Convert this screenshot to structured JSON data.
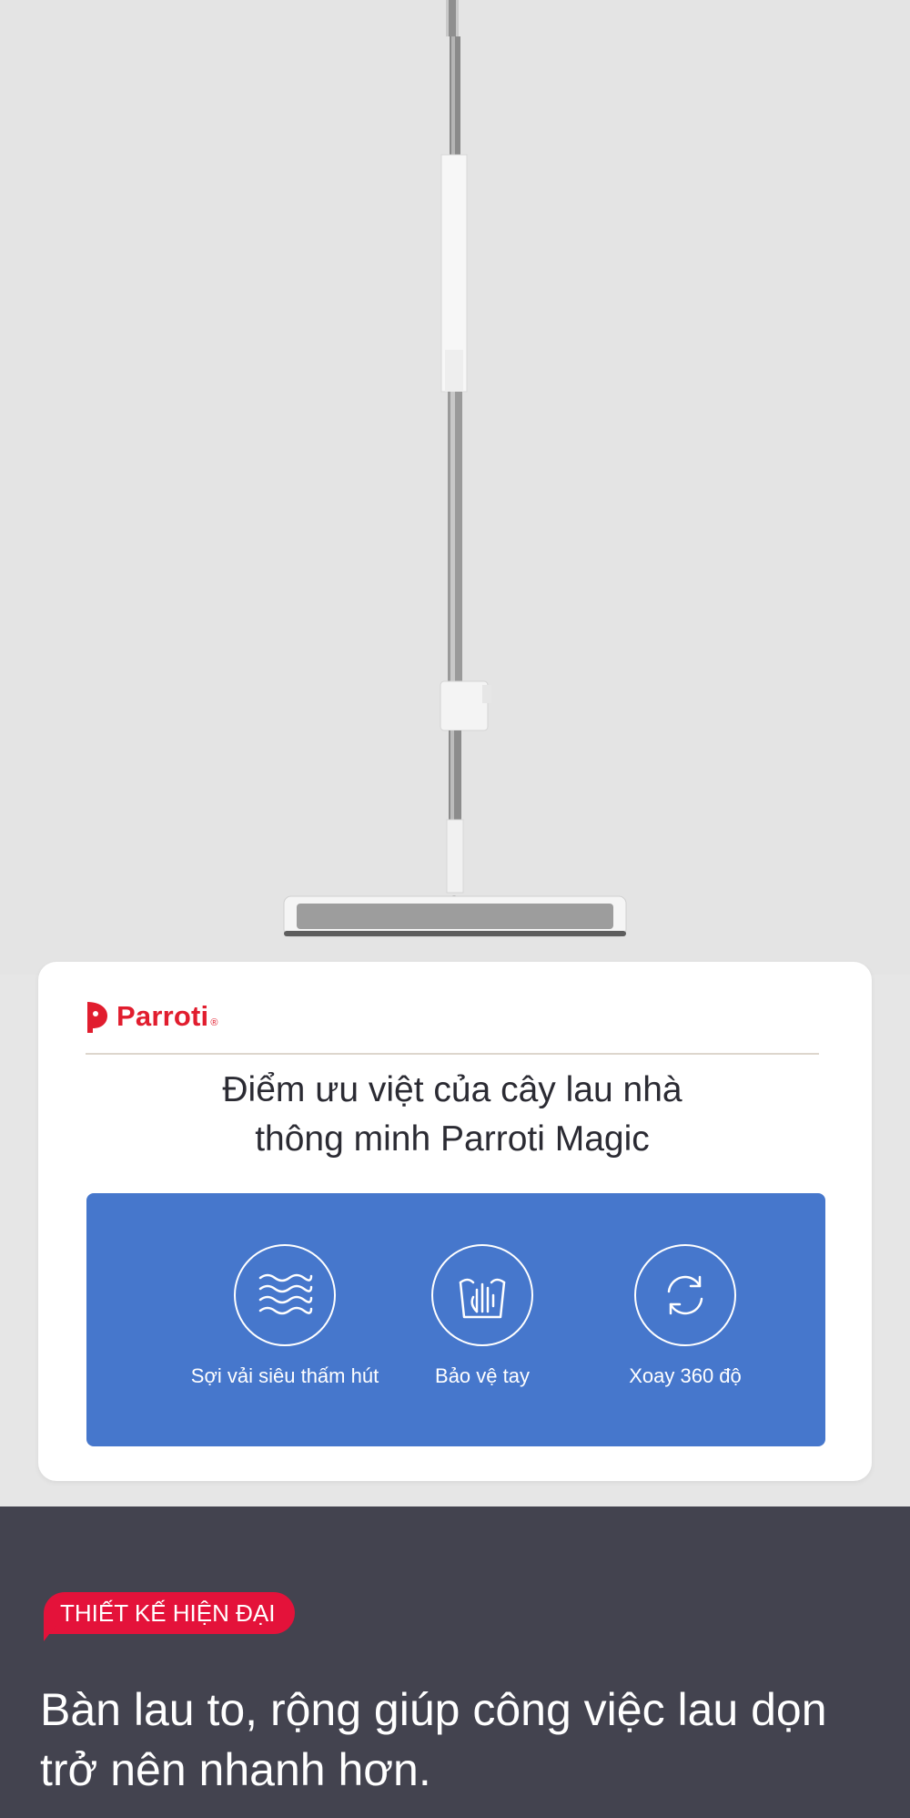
{
  "brand": {
    "name": "Parroti",
    "registered": "®",
    "color": "#e11d2e"
  },
  "card": {
    "title_line1": "Điểm ưu việt của cây lau nhà",
    "title_line2": "thông minh Parroti Magic"
  },
  "features": [
    {
      "label": "Sợi vải siêu thấm hút",
      "icon": "absorbent-fiber-icon"
    },
    {
      "label": "Bảo vệ tay",
      "icon": "hand-protection-icon"
    },
    {
      "label": "Xoay 360 độ",
      "icon": "rotate-360-icon"
    }
  ],
  "section": {
    "tag": "THIẾT KẾ HIỆN ĐẠI",
    "headline_line1": "Bàn lau to, rộng giúp công việc lau dọn",
    "headline_line2": "trở nên nhanh hơn."
  },
  "colors": {
    "accent_blue": "#4677cc",
    "tag_red": "#e4123a",
    "dark_bg": "#43434f"
  }
}
